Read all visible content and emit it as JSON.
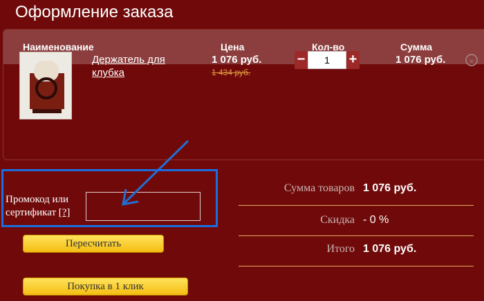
{
  "page": {
    "title": "Оформление заказа"
  },
  "cart": {
    "columns": {
      "name": "Наименование",
      "price": "Цена",
      "qty": "Кол-во",
      "sum": "Сумма"
    },
    "item": {
      "name": "Держатель для клубка",
      "price": "1 076 руб.",
      "old_price": "1 434 руб.",
      "qty": "1",
      "sum": "1 076 руб.",
      "minus": "−",
      "plus": "+",
      "remove": "×"
    }
  },
  "promo": {
    "label": "Промокод или сертификат",
    "help": "[?]",
    "value": ""
  },
  "summary": {
    "goods_label": "Сумма товаров",
    "goods_value": "1 076 руб.",
    "discount_label": "Скидка",
    "discount_value": "- 0 %",
    "total_label": "Итого",
    "total_value": "1 076 руб."
  },
  "buttons": {
    "recalc": "Пересчитать",
    "oneclick": "Покупка в 1 клик"
  },
  "colors": {
    "background": "#700a0a",
    "header": "#8c3e3e",
    "accent_blue": "#1a6fe0",
    "button": "#f4bd12"
  }
}
